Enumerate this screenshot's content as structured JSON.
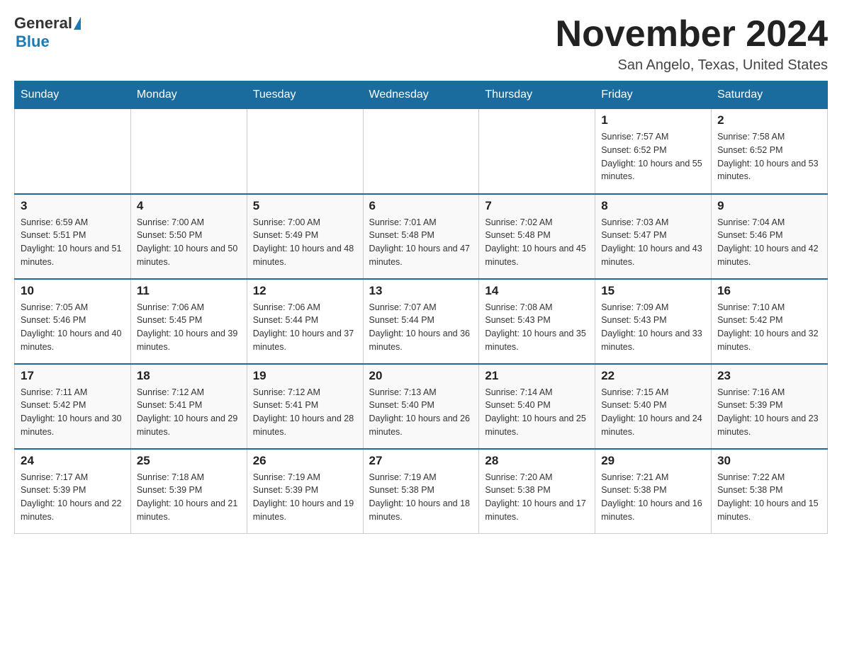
{
  "logo": {
    "general": "General",
    "blue": "Blue"
  },
  "title": "November 2024",
  "location": "San Angelo, Texas, United States",
  "days_of_week": [
    "Sunday",
    "Monday",
    "Tuesday",
    "Wednesday",
    "Thursday",
    "Friday",
    "Saturday"
  ],
  "weeks": [
    [
      {
        "day": "",
        "info": ""
      },
      {
        "day": "",
        "info": ""
      },
      {
        "day": "",
        "info": ""
      },
      {
        "day": "",
        "info": ""
      },
      {
        "day": "",
        "info": ""
      },
      {
        "day": "1",
        "info": "Sunrise: 7:57 AM\nSunset: 6:52 PM\nDaylight: 10 hours and 55 minutes."
      },
      {
        "day": "2",
        "info": "Sunrise: 7:58 AM\nSunset: 6:52 PM\nDaylight: 10 hours and 53 minutes."
      }
    ],
    [
      {
        "day": "3",
        "info": "Sunrise: 6:59 AM\nSunset: 5:51 PM\nDaylight: 10 hours and 51 minutes."
      },
      {
        "day": "4",
        "info": "Sunrise: 7:00 AM\nSunset: 5:50 PM\nDaylight: 10 hours and 50 minutes."
      },
      {
        "day": "5",
        "info": "Sunrise: 7:00 AM\nSunset: 5:49 PM\nDaylight: 10 hours and 48 minutes."
      },
      {
        "day": "6",
        "info": "Sunrise: 7:01 AM\nSunset: 5:48 PM\nDaylight: 10 hours and 47 minutes."
      },
      {
        "day": "7",
        "info": "Sunrise: 7:02 AM\nSunset: 5:48 PM\nDaylight: 10 hours and 45 minutes."
      },
      {
        "day": "8",
        "info": "Sunrise: 7:03 AM\nSunset: 5:47 PM\nDaylight: 10 hours and 43 minutes."
      },
      {
        "day": "9",
        "info": "Sunrise: 7:04 AM\nSunset: 5:46 PM\nDaylight: 10 hours and 42 minutes."
      }
    ],
    [
      {
        "day": "10",
        "info": "Sunrise: 7:05 AM\nSunset: 5:46 PM\nDaylight: 10 hours and 40 minutes."
      },
      {
        "day": "11",
        "info": "Sunrise: 7:06 AM\nSunset: 5:45 PM\nDaylight: 10 hours and 39 minutes."
      },
      {
        "day": "12",
        "info": "Sunrise: 7:06 AM\nSunset: 5:44 PM\nDaylight: 10 hours and 37 minutes."
      },
      {
        "day": "13",
        "info": "Sunrise: 7:07 AM\nSunset: 5:44 PM\nDaylight: 10 hours and 36 minutes."
      },
      {
        "day": "14",
        "info": "Sunrise: 7:08 AM\nSunset: 5:43 PM\nDaylight: 10 hours and 35 minutes."
      },
      {
        "day": "15",
        "info": "Sunrise: 7:09 AM\nSunset: 5:43 PM\nDaylight: 10 hours and 33 minutes."
      },
      {
        "day": "16",
        "info": "Sunrise: 7:10 AM\nSunset: 5:42 PM\nDaylight: 10 hours and 32 minutes."
      }
    ],
    [
      {
        "day": "17",
        "info": "Sunrise: 7:11 AM\nSunset: 5:42 PM\nDaylight: 10 hours and 30 minutes."
      },
      {
        "day": "18",
        "info": "Sunrise: 7:12 AM\nSunset: 5:41 PM\nDaylight: 10 hours and 29 minutes."
      },
      {
        "day": "19",
        "info": "Sunrise: 7:12 AM\nSunset: 5:41 PM\nDaylight: 10 hours and 28 minutes."
      },
      {
        "day": "20",
        "info": "Sunrise: 7:13 AM\nSunset: 5:40 PM\nDaylight: 10 hours and 26 minutes."
      },
      {
        "day": "21",
        "info": "Sunrise: 7:14 AM\nSunset: 5:40 PM\nDaylight: 10 hours and 25 minutes."
      },
      {
        "day": "22",
        "info": "Sunrise: 7:15 AM\nSunset: 5:40 PM\nDaylight: 10 hours and 24 minutes."
      },
      {
        "day": "23",
        "info": "Sunrise: 7:16 AM\nSunset: 5:39 PM\nDaylight: 10 hours and 23 minutes."
      }
    ],
    [
      {
        "day": "24",
        "info": "Sunrise: 7:17 AM\nSunset: 5:39 PM\nDaylight: 10 hours and 22 minutes."
      },
      {
        "day": "25",
        "info": "Sunrise: 7:18 AM\nSunset: 5:39 PM\nDaylight: 10 hours and 21 minutes."
      },
      {
        "day": "26",
        "info": "Sunrise: 7:19 AM\nSunset: 5:39 PM\nDaylight: 10 hours and 19 minutes."
      },
      {
        "day": "27",
        "info": "Sunrise: 7:19 AM\nSunset: 5:38 PM\nDaylight: 10 hours and 18 minutes."
      },
      {
        "day": "28",
        "info": "Sunrise: 7:20 AM\nSunset: 5:38 PM\nDaylight: 10 hours and 17 minutes."
      },
      {
        "day": "29",
        "info": "Sunrise: 7:21 AM\nSunset: 5:38 PM\nDaylight: 10 hours and 16 minutes."
      },
      {
        "day": "30",
        "info": "Sunrise: 7:22 AM\nSunset: 5:38 PM\nDaylight: 10 hours and 15 minutes."
      }
    ]
  ]
}
